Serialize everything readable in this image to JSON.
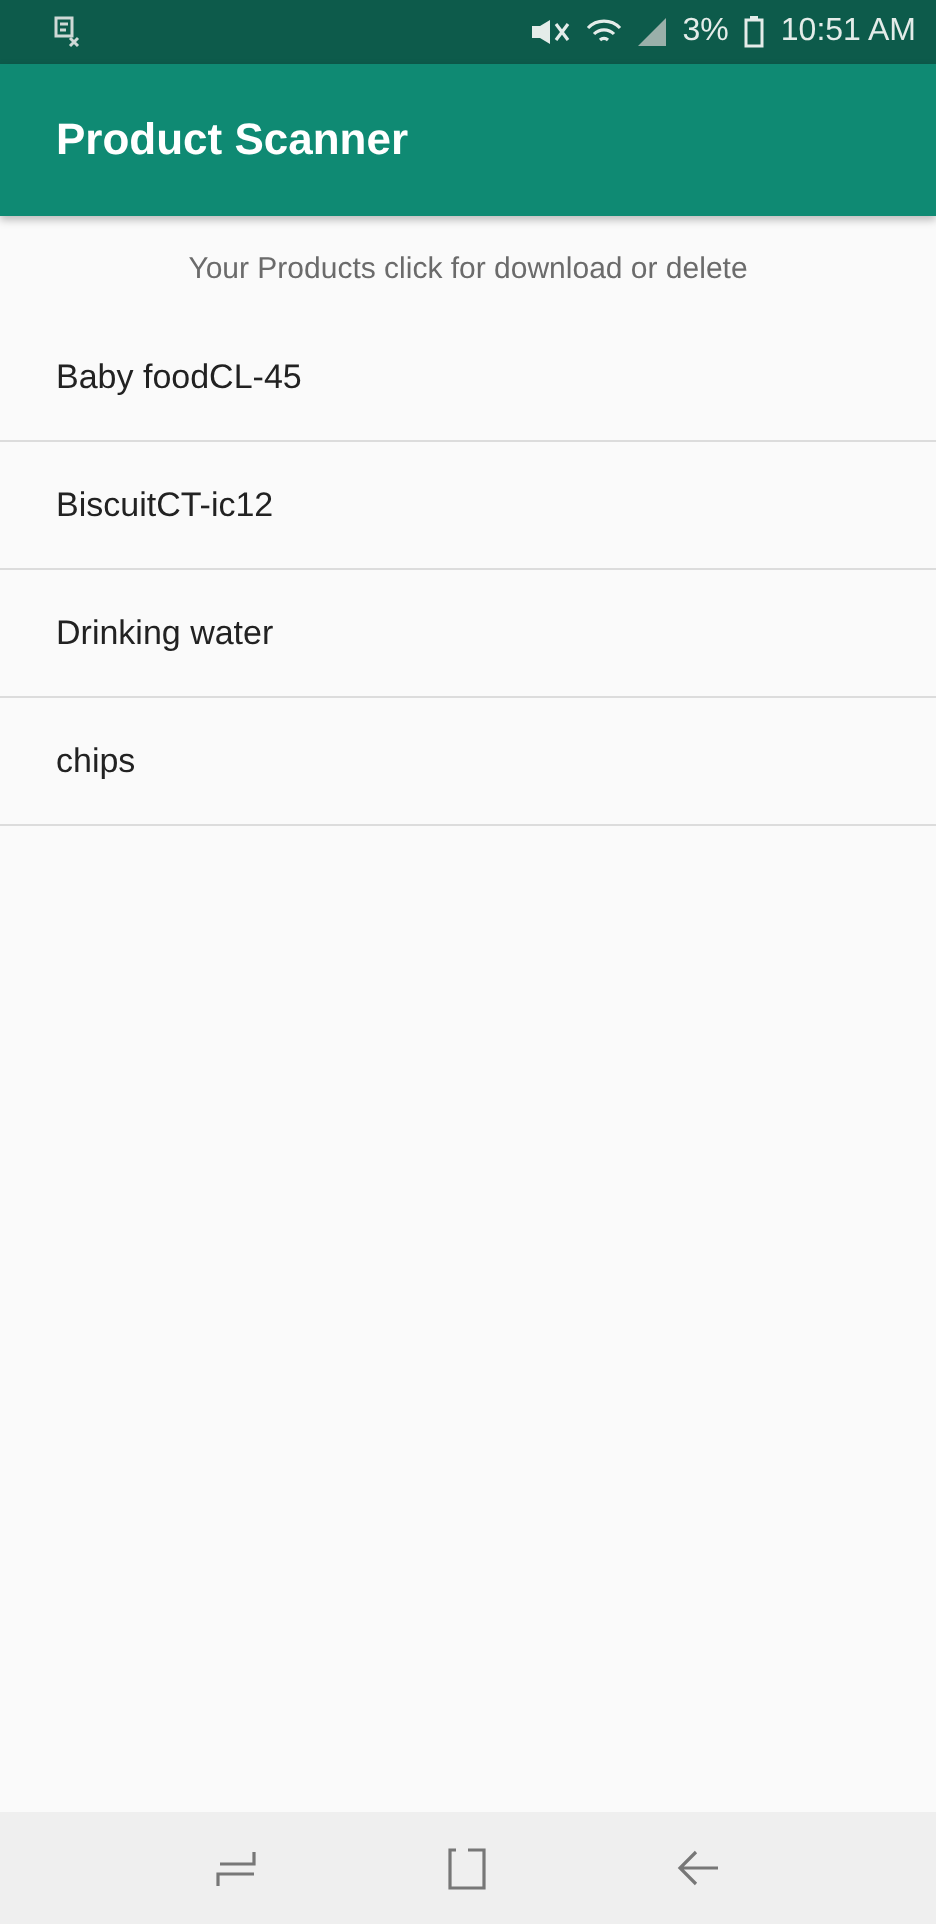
{
  "status_bar": {
    "battery": "3%",
    "time": "10:51 AM"
  },
  "app_bar": {
    "title": "Product Scanner"
  },
  "hint": "Your Products click for download or delete",
  "products": [
    "Baby foodCL-45",
    "BiscuitCT-ic12",
    "Drinking water",
    "chips"
  ]
}
